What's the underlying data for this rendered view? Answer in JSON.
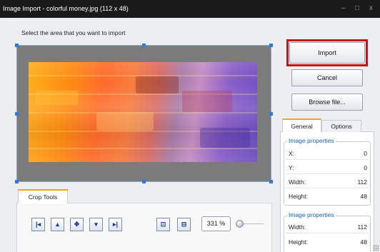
{
  "window": {
    "title": "Image Import - colorful money.jpg  (112 x 48)",
    "minimize_glyph": "–",
    "maximize_glyph": "□",
    "close_glyph": "x"
  },
  "prompt": "Select the area that you want to import",
  "buttons": {
    "import": "Import",
    "cancel": "Cancel",
    "browse": "Browse file..."
  },
  "tabs": {
    "general": "General",
    "options": "Options"
  },
  "properties": {
    "group1_title": "Image properties",
    "group1_rows": [
      {
        "label": "X:",
        "value": "0"
      },
      {
        "label": "Y:",
        "value": "0"
      },
      {
        "label": "Width:",
        "value": "112"
      },
      {
        "label": "Height:",
        "value": "48"
      }
    ],
    "group2_title": "Image properties",
    "group2_rows": [
      {
        "label": "Width:",
        "value": "112"
      },
      {
        "label": "Height:",
        "value": "48"
      }
    ]
  },
  "crop_tools": {
    "tab_label": "Crop Tools",
    "zoom": "331 %",
    "icons": [
      "align-left-icon",
      "align-top-icon",
      "center-icon",
      "align-bottom-icon",
      "align-right-icon",
      "fit-to-window-icon",
      "actual-size-icon"
    ]
  },
  "colors": {
    "accent_red": "#c2161c",
    "tab_accent": "#f0a900",
    "group_title_blue": "#1d5fbf",
    "handle_blue": "#2a7be4"
  }
}
